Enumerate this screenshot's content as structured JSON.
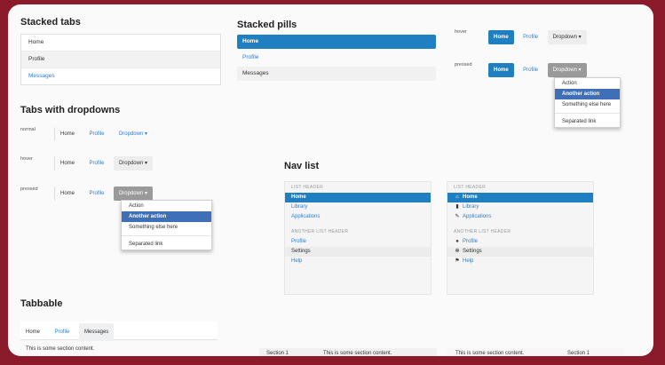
{
  "stacked_tabs": {
    "title": "Stacked tabs",
    "items": [
      "Home",
      "Profile",
      "Messages"
    ]
  },
  "stacked_pills": {
    "title": "Stacked pills",
    "items": [
      "Home",
      "Profile",
      "Messages"
    ]
  },
  "top_states": {
    "hover_label": "hover",
    "pressed_label": "pressed",
    "home": "Home",
    "profile": "Profile",
    "dropdown": "Dropdown ▾"
  },
  "tabs_with_dropdowns": {
    "title": "Tabs with dropdowns",
    "normal_label": "normal",
    "hover_label": "hover",
    "pressed_label": "pressed",
    "home": "Home",
    "profile": "Profile",
    "dropdown": "Dropdown ▾"
  },
  "dropdown_menu": [
    "Action",
    "Another action",
    "Something else here",
    "Separated link"
  ],
  "nav_list": {
    "title": "Nav list",
    "header1": "LIST HEADER",
    "items1": [
      "Home",
      "Library",
      "Applications"
    ],
    "header2": "ANOTHER LIST HEADER",
    "items2": [
      "Profile",
      "Settings",
      "Help"
    ],
    "icons": [
      "home-icon",
      "book-icon",
      "pencil-icon",
      "user-icon",
      "gear-icon",
      "flag-icon"
    ]
  },
  "tabbable": {
    "title": "Tabbable",
    "tabs": [
      "Home",
      "Profile",
      "Messages"
    ],
    "content": "This is some section content.",
    "section": "Section 1"
  }
}
